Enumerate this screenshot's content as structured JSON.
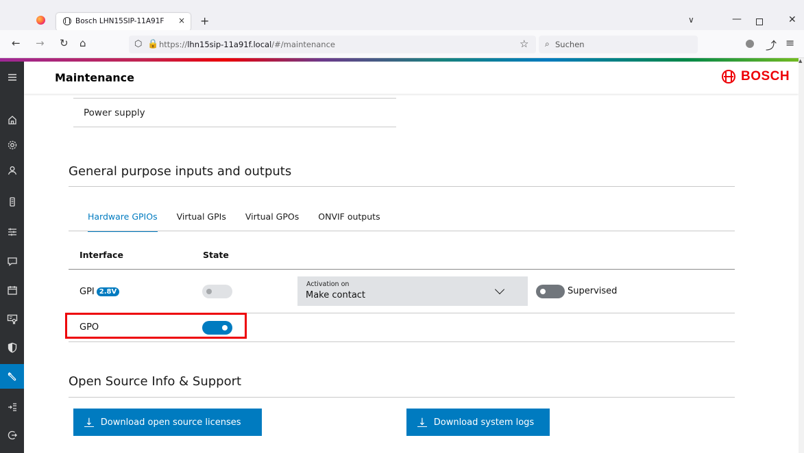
{
  "browser": {
    "tab_title": "Bosch LHN15SIP-11A91F",
    "tab_close": "×",
    "new_tab": "+",
    "url_prefix": "https://",
    "url_host": "lhn15sip-11a91f.local",
    "url_path": "/#/maintenance",
    "search_placeholder": "Suchen"
  },
  "header": {
    "title": "Maintenance",
    "brand": "BOSCH"
  },
  "sidebar": {
    "items": [
      {
        "icon": "menu-icon"
      },
      {
        "icon": "home-icon"
      },
      {
        "icon": "gear-icon"
      },
      {
        "icon": "user-icon"
      },
      {
        "icon": "phone-icon"
      },
      {
        "icon": "sliders-icon"
      },
      {
        "icon": "chat-icon"
      },
      {
        "icon": "calendar-icon"
      },
      {
        "icon": "certificate-icon"
      },
      {
        "icon": "shield-icon"
      },
      {
        "icon": "wrench-icon",
        "active": true
      },
      {
        "icon": "import-icon"
      },
      {
        "icon": "logout-icon"
      }
    ]
  },
  "main": {
    "power_supply": "Power supply",
    "gpio": {
      "title": "General purpose inputs and outputs",
      "tabs": [
        {
          "label": "Hardware GPIOs",
          "active": true
        },
        {
          "label": "Virtual GPIs"
        },
        {
          "label": "Virtual GPOs"
        },
        {
          "label": "ONVIF outputs"
        }
      ],
      "columns": [
        "Interface",
        "State"
      ],
      "rows": {
        "gpi": {
          "label": "GPI",
          "badge": "2.8V",
          "state": "off (disabled)",
          "activation_label": "Activation on",
          "activation_value": "Make contact",
          "supervised_label": "Supervised",
          "supervised": "off"
        },
        "gpo": {
          "label": "GPO",
          "state": "on"
        }
      }
    },
    "open_source": {
      "title": "Open Source Info & Support",
      "download_licenses": "Download open source licenses",
      "download_logs": "Download system logs"
    }
  },
  "colors": {
    "accent": "#007bc0",
    "sidebar_bg": "#2e3033",
    "brand_red": "#ed0007",
    "highlight": "#ed0007"
  }
}
